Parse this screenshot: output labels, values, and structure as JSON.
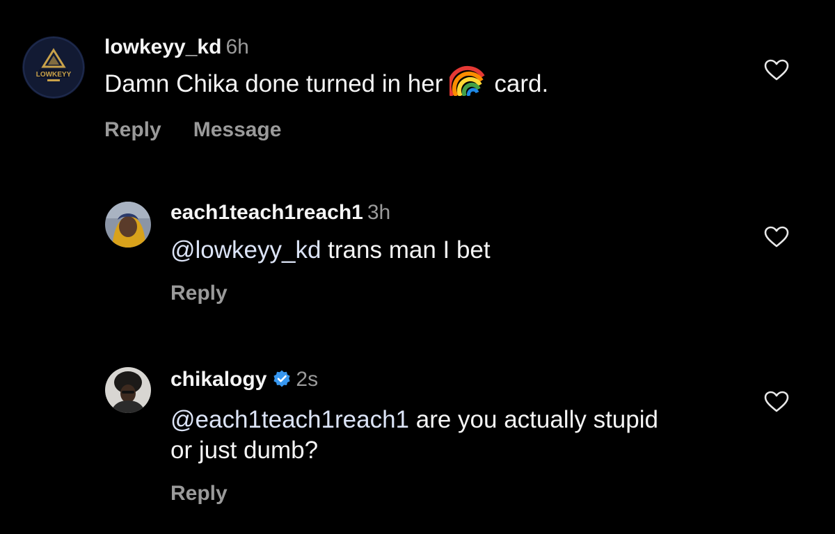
{
  "comments": [
    {
      "username": "lowkeyy_kd",
      "time": "6h",
      "text_before": "Damn Chika done turned in her",
      "emoji": "rainbow",
      "text_after": "card.",
      "avatar_text": "LOWKEYY",
      "actions": {
        "reply": "Reply",
        "message": "Message"
      },
      "liked": false
    },
    {
      "username": "each1teach1reach1",
      "time": "3h",
      "mention": "@lowkeyy_kd",
      "text": " trans man I bet",
      "actions": {
        "reply": "Reply"
      },
      "liked": false
    },
    {
      "username": "chikalogy",
      "verified": true,
      "time": "2s",
      "mention": "@each1teach1reach1",
      "text_line1": " are you actually stupid",
      "text_line2": "or just dumb?",
      "actions": {
        "reply": "Reply"
      },
      "liked": false
    }
  ],
  "colors": {
    "background": "#000000",
    "text": "#f5f5f5",
    "secondary": "#9a9a9a",
    "verified": "#3797f0"
  },
  "icons": [
    "heart-icon",
    "verified-badge-icon",
    "rainbow-emoji"
  ]
}
